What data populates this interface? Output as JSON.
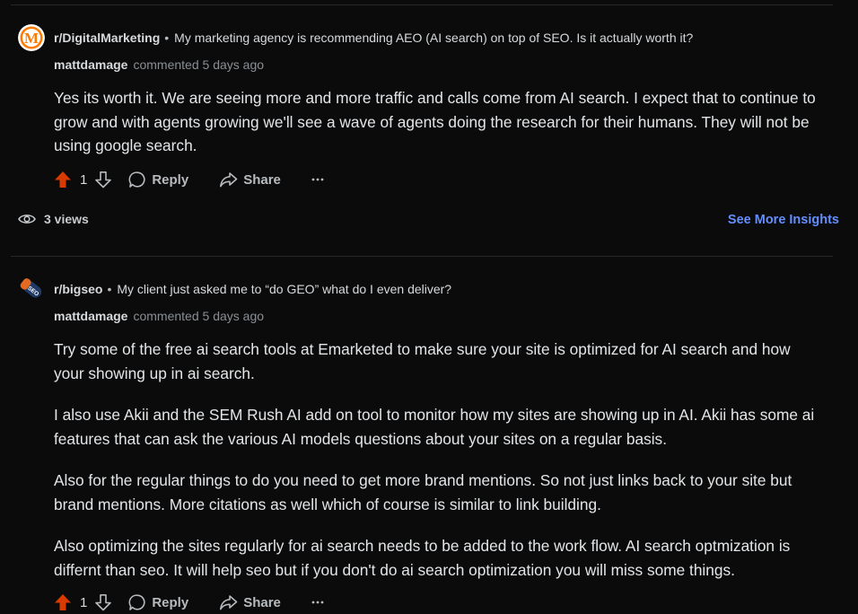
{
  "comments": [
    {
      "subreddit": "r/DigitalMarketing",
      "post_title": "My marketing agency is recommending AEO (AI search) on top of SEO. Is it actually worth it?",
      "author": "mattdamage",
      "commented": "commented",
      "time": "5 days ago",
      "paragraphs": [
        "Yes its worth it. We are seeing more and more traffic and calls come from AI search. I expect that to continue to grow and with agents growing we'll see a wave of agents doing the research for their humans. They will not be using google search."
      ],
      "votes": "1",
      "reply": "Reply",
      "share": "Share",
      "views": "3 views",
      "insights": "See More Insights"
    },
    {
      "subreddit": "r/bigseo",
      "post_title": "My client just asked me to “do GEO” what do I even deliver?",
      "author": "mattdamage",
      "commented": "commented",
      "time": "5 days ago",
      "paragraphs": [
        "Try some of the free ai search tools at Emarketed to make sure your site is optimized for AI search and how your showing up in ai search.",
        "I also use Akii and the SEM Rush AI add on tool to monitor how my sites are showing up in AI. Akii has some ai features that can ask the various AI models questions about your sites on a regular basis.",
        "Also for the regular things to do you need to get more brand mentions. So not just links back to your site but brand mentions. More citations as well which of course is similar to link building.",
        "Also optimizing the sites regularly for ai search needs to be added to the work flow. AI search optmization is differnt than seo. It will help seo but if you don't do ai search optimization you will miss some things."
      ],
      "votes": "1",
      "reply": "Reply",
      "share": "Share"
    }
  ],
  "icons": {
    "upvote": "upvote-filled-icon",
    "downvote": "downvote-icon",
    "reply": "comment-bubble-icon",
    "share": "share-arrow-icon",
    "more": "more-horizontal-icon",
    "views": "eye-icon"
  },
  "colors": {
    "background": "#0b0b0c",
    "upvote_active": "#d93a00",
    "link": "#648efc",
    "avatar_digitalmarketing": "#ff7a00"
  },
  "avatars": {
    "digitalmarketing_letter": "M",
    "bigseo_text": "SEO"
  }
}
